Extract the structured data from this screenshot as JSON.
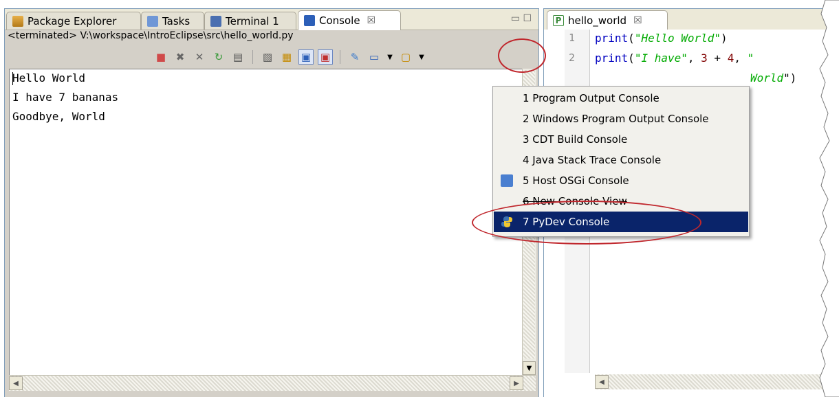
{
  "left_tabs": [
    {
      "label": "Package Explorer",
      "icon": "package-explorer-icon"
    },
    {
      "label": "Tasks",
      "icon": "tasks-icon"
    },
    {
      "label": "Terminal 1",
      "icon": "terminal-icon"
    },
    {
      "label": "Console",
      "icon": "console-icon",
      "close": "☒"
    }
  ],
  "left_window_controls": "▭ ☐",
  "console_status": "<terminated> V:\\workspace\\IntroEclipse\\src\\hello_world.py",
  "toolbar_icons": [
    "terminate-icon",
    "remove-launch-icon",
    "remove-all-icon",
    "relaunch-icon",
    "clear-console-icon",
    "scroll-lock-icon",
    "word-wrap-icon",
    "show-on-stdout-icon",
    "show-on-stderr-icon",
    "pin-console-icon",
    "display-console-icon",
    "dropdown-arrow-icon",
    "open-console-icon",
    "open-console-dropdown-icon"
  ],
  "console_output": [
    "Hello World",
    "I have 7 bananas",
    "Goodbye, World"
  ],
  "editor_tab": {
    "label": "hello_world",
    "close": "☒",
    "icon_letter": "P"
  },
  "editor_lines": [
    {
      "num": "1",
      "text": "print(\"Hello World\")"
    },
    {
      "num": "2",
      "text": "print(\"I have\", 3 + 4, \""
    }
  ],
  "editor_fragment": "World\")",
  "menu_items": [
    {
      "label": "1 Program Output Console"
    },
    {
      "label": "2 Windows Program Output Console"
    },
    {
      "label": "3 CDT Build Console"
    },
    {
      "label": "4 Java Stack Trace Console"
    },
    {
      "label": "5 Host OSGi Console",
      "icon": "osgi-console-icon"
    },
    {
      "label": "6 New Console View"
    },
    {
      "label": "7 PyDev Console",
      "icon": "python-icon",
      "selected": true
    }
  ],
  "colors": {
    "selection": "#0a246a",
    "annotation": "#c0272d",
    "code_keyword": "#0000c0",
    "code_string": "#00aa00"
  }
}
